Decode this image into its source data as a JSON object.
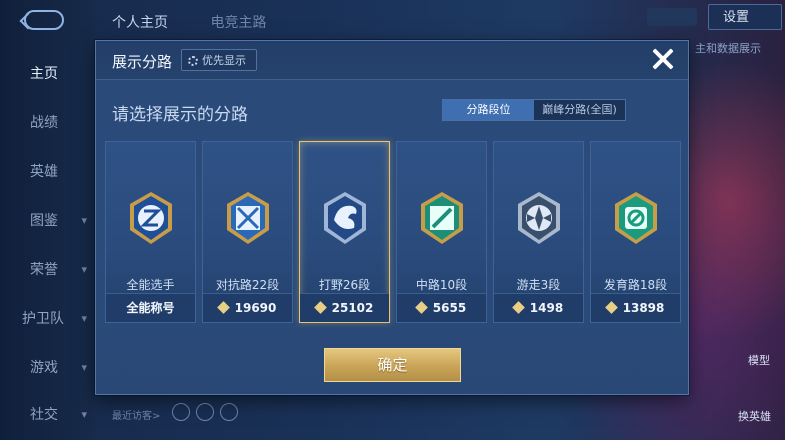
{
  "background": {
    "top_tabs": [
      "个人主页",
      "电竞主路"
    ],
    "settings_label": "设置",
    "hint_text": "主和数据展示",
    "recent_visitors": "最近访客>",
    "switch_hero": "换英雄",
    "model_label": "模型"
  },
  "sidebar": {
    "items": [
      {
        "label": "主页"
      },
      {
        "label": "战绩"
      },
      {
        "label": "英雄"
      },
      {
        "label": "图鉴"
      },
      {
        "label": "荣誉"
      },
      {
        "label": "护卫队"
      },
      {
        "label": "游戏"
      },
      {
        "label": "社交"
      }
    ]
  },
  "dialog": {
    "title": "展示分路",
    "priority_label": "优先显示",
    "prompt": "请选择展示的分路",
    "tabs": [
      {
        "label": "分路段位",
        "active": true
      },
      {
        "label": "巅峰分路(全国)",
        "active": false
      }
    ],
    "cards": [
      {
        "name": "全能选手",
        "value": "全能称号",
        "has_diamond": false,
        "selected": false,
        "icon": "all-round-emblem-icon"
      },
      {
        "name": "对抗路22段",
        "value": "19690",
        "has_diamond": true,
        "selected": false,
        "icon": "clash-lane-emblem-icon"
      },
      {
        "name": "打野26段",
        "value": "25102",
        "has_diamond": true,
        "selected": true,
        "icon": "jungle-emblem-icon"
      },
      {
        "name": "中路10段",
        "value": "5655",
        "has_diamond": true,
        "selected": false,
        "icon": "mid-lane-emblem-icon"
      },
      {
        "name": "游走3段",
        "value": "1498",
        "has_diamond": true,
        "selected": false,
        "icon": "roam-emblem-icon"
      },
      {
        "name": "发育路18段",
        "value": "13898",
        "has_diamond": true,
        "selected": false,
        "icon": "farm-lane-emblem-icon"
      }
    ],
    "confirm_label": "确定"
  },
  "colors": {
    "accent_gold": "#e5c77f",
    "dialog_bg": "#2b4c7b",
    "tab_active": "#3f6fb0"
  }
}
